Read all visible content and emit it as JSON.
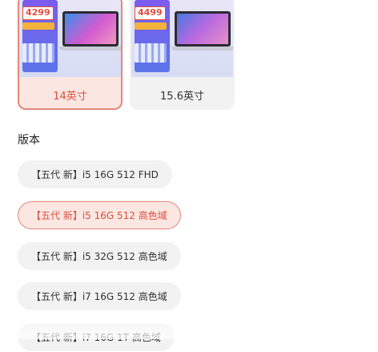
{
  "size_options": [
    {
      "label": "14英寸",
      "price": "4299",
      "selected": true
    },
    {
      "label": "15.6英寸",
      "price": "4499",
      "selected": false
    }
  ],
  "version_section": {
    "title": "版本",
    "options": [
      {
        "label": "【五代 新】i5 16G 512 FHD",
        "selected": false
      },
      {
        "label": "【五代 新】i5 16G 512 高色域",
        "selected": true
      },
      {
        "label": "【五代 新】i5 32G 512 高色域",
        "selected": false
      },
      {
        "label": "【五代 新】i7 16G 512 高色域",
        "selected": false
      },
      {
        "label": "【五代 新】i7 16G 1T 高色域",
        "selected": false
      }
    ]
  },
  "colors": {
    "accent": "#d9503e",
    "accent_border": "#e2897a",
    "selected_bg": "#fbe6e2",
    "chip_bg": "#f2f2f2",
    "price_red": "#e84b3c"
  }
}
